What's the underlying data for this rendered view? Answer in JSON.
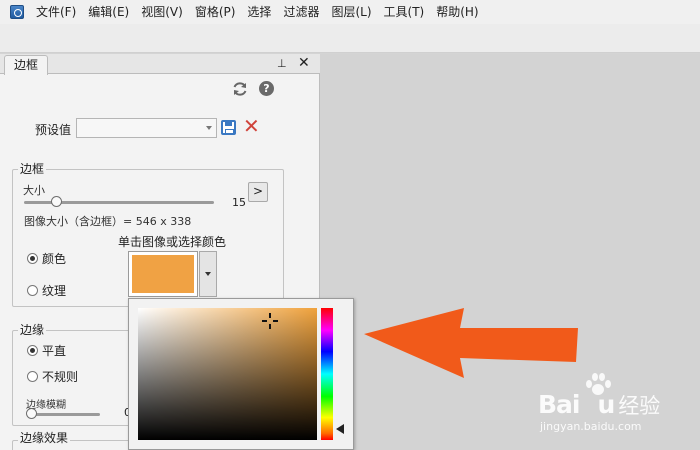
{
  "menubar": {
    "items": [
      "文件(F)",
      "编辑(E)",
      "视图(V)",
      "窗格(P)",
      "选择",
      "过滤器",
      "图层(L)",
      "工具(T)",
      "帮助(H)"
    ]
  },
  "panel": {
    "tab_label": "边框",
    "pin_glyph": "⊥",
    "close_glyph": "✕",
    "help_glyph": "?",
    "preset": {
      "label": "预设值",
      "value": ""
    },
    "border_group": {
      "legend": "边框",
      "size_label": "大小",
      "size_value": "15",
      "size_fraction": 0.17,
      "expand_glyph": ">",
      "image_size_text": "图像大小（含边框）= 546 x 338",
      "color_hint": "单击图像或选择颜色",
      "fill_options": [
        {
          "label": "颜色",
          "checked": true
        },
        {
          "label": "纹理",
          "checked": false
        }
      ],
      "selected_color": "#f0a244"
    },
    "edge_group": {
      "legend": "边缘",
      "options": [
        {
          "label": "平直",
          "checked": true
        },
        {
          "label": "不规则",
          "checked": false
        }
      ],
      "feather_label": "边缘模糊",
      "feather_value": "0",
      "feather_fraction": 0.0
    },
    "effect_group": {
      "legend": "边缘效果"
    }
  },
  "color_picker": {
    "base_hue": "#f0a23c",
    "hue_position": 0.92
  },
  "annotation": {
    "arrow_color": "#f15a1a"
  },
  "watermark": {
    "logo_text": "Bai",
    "logo_text_end": "u",
    "logo_cn": "经验",
    "url": "jingyan.baidu.com"
  }
}
